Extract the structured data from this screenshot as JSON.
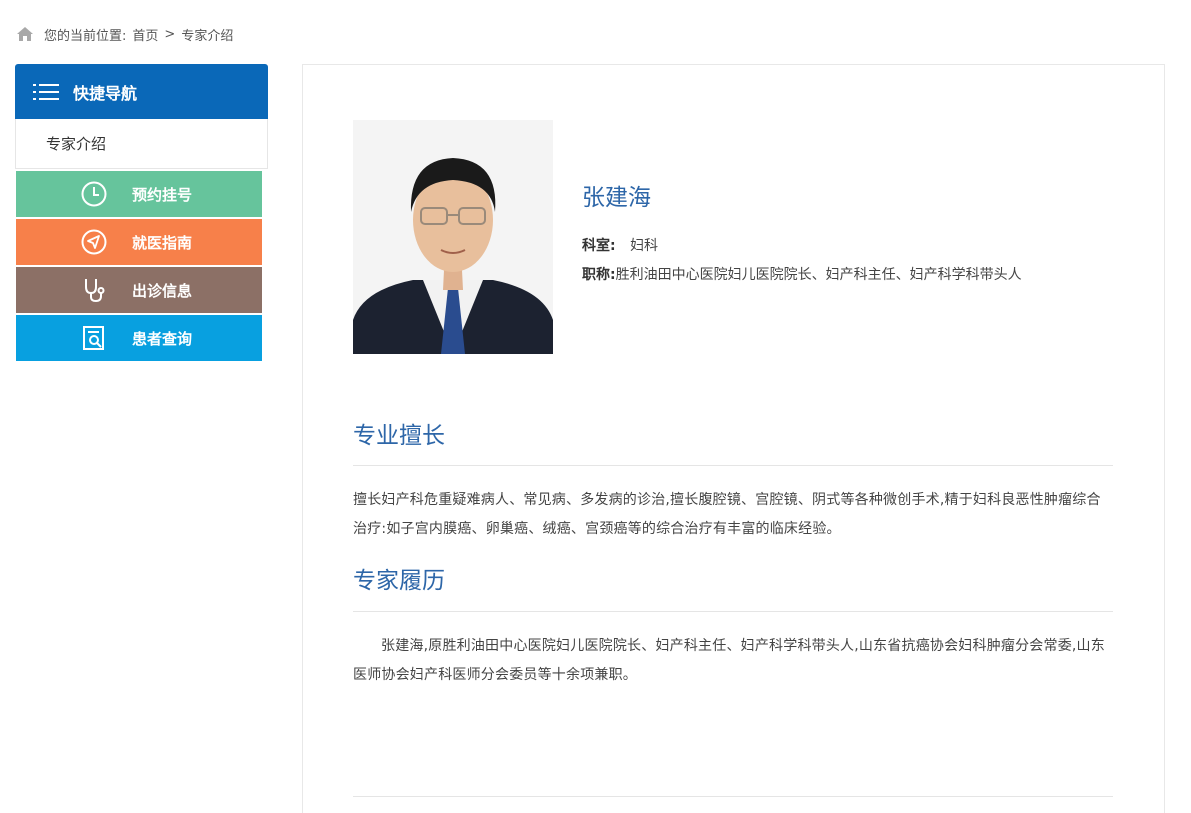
{
  "breadcrumb": {
    "icon": "home-icon",
    "prefix": "您的当前位置:",
    "home": "首页",
    "separator": ">",
    "current": "专家介绍"
  },
  "sidebar": {
    "header": {
      "icon": "list-menu-icon",
      "title": "快捷导航"
    },
    "current_item": "专家介绍",
    "quick_links": [
      {
        "label": "预约挂号",
        "icon": "clock-icon",
        "color": "#66c49c"
      },
      {
        "label": "就医指南",
        "icon": "navigation-arrow-icon",
        "color": "#f7804a"
      },
      {
        "label": "出诊信息",
        "icon": "stethoscope-icon",
        "color": "#8c7066"
      },
      {
        "label": "患者查询",
        "icon": "document-search-icon",
        "color": "#08a0e0"
      }
    ]
  },
  "doctor": {
    "name": "张建海",
    "dept_label": "科室:",
    "dept_value": "妇科",
    "title_label": "职称:",
    "title_value": "胜利油田中心医院妇儿医院院长、妇产科主任、妇产科学科带头人"
  },
  "sections": {
    "specialty": {
      "title": "专业擅长",
      "text": "擅长妇产科危重疑难病人、常见病、多发病的诊治,擅长腹腔镜、宫腔镜、阴式等各种微创手术,精于妇科良恶性肿瘤综合治疗:如子宫内膜癌、卵巢癌、绒癌、宫颈癌等的综合治疗有丰富的临床经验。"
    },
    "resume": {
      "title": "专家履历",
      "text": "张建海,原胜利油田中心医院妇儿医院院长、妇产科主任、妇产科学科带头人,山东省抗癌协会妇科肿瘤分会常委,山东医师协会妇产科医师分会委员等十余项兼职。"
    }
  },
  "colors": {
    "nav_header": "#0a68b8",
    "heading_blue": "#2d66a8"
  }
}
